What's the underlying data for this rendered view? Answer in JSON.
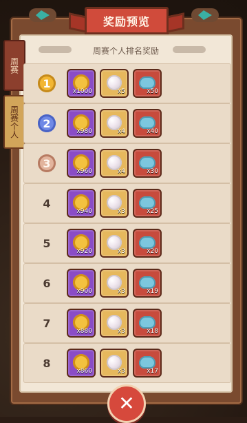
{
  "title": "奖励预览",
  "subtitle": "周赛个人排名奖励",
  "tabs": [
    {
      "label": "周赛"
    },
    {
      "label": "周赛个人"
    }
  ],
  "rewards": [
    {
      "rank": "1",
      "medal": "gold",
      "items": [
        {
          "icon": "coin-icon",
          "count": "x1000"
        },
        {
          "icon": "pearl-icon",
          "count": "x5"
        },
        {
          "icon": "plate-icon",
          "count": "x50"
        }
      ]
    },
    {
      "rank": "2",
      "medal": "silver",
      "items": [
        {
          "icon": "coin-icon",
          "count": "x980"
        },
        {
          "icon": "pearl-icon",
          "count": "x4"
        },
        {
          "icon": "plate-icon",
          "count": "x40"
        }
      ]
    },
    {
      "rank": "3",
      "medal": "bronze",
      "items": [
        {
          "icon": "coin-icon",
          "count": "x960"
        },
        {
          "icon": "pearl-icon",
          "count": "x4"
        },
        {
          "icon": "plate-icon",
          "count": "x30"
        }
      ]
    },
    {
      "rank": "4",
      "medal": "none",
      "items": [
        {
          "icon": "coin-icon",
          "count": "x940"
        },
        {
          "icon": "pearl-icon",
          "count": "x3"
        },
        {
          "icon": "plate-icon",
          "count": "x25"
        }
      ]
    },
    {
      "rank": "5",
      "medal": "none",
      "items": [
        {
          "icon": "coin-icon",
          "count": "x920"
        },
        {
          "icon": "pearl-icon",
          "count": "x3"
        },
        {
          "icon": "plate-icon",
          "count": "x20"
        }
      ]
    },
    {
      "rank": "6",
      "medal": "none",
      "items": [
        {
          "icon": "coin-icon",
          "count": "x900"
        },
        {
          "icon": "pearl-icon",
          "count": "x3"
        },
        {
          "icon": "plate-icon",
          "count": "x19"
        }
      ]
    },
    {
      "rank": "7",
      "medal": "none",
      "items": [
        {
          "icon": "coin-icon",
          "count": "x880"
        },
        {
          "icon": "pearl-icon",
          "count": "x3"
        },
        {
          "icon": "plate-icon",
          "count": "x18"
        }
      ]
    },
    {
      "rank": "8",
      "medal": "none",
      "items": [
        {
          "icon": "coin-icon",
          "count": "x860"
        },
        {
          "icon": "pearl-icon",
          "count": "x3"
        },
        {
          "icon": "plate-icon",
          "count": "x17"
        }
      ]
    }
  ],
  "close_icon": "close-icon",
  "colors": {
    "title_red": "#d04b3b",
    "frame_brown": "#7a4a2f",
    "paper": "#f2e7d7"
  }
}
